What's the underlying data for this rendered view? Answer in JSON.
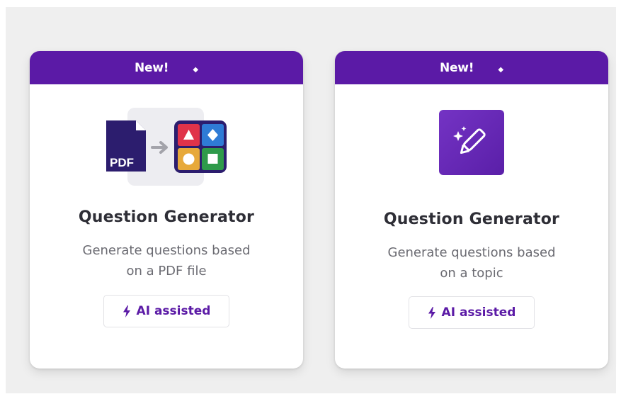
{
  "cards": [
    {
      "banner": "New!",
      "title": "Question Generator",
      "description_line1": "Generate questions based",
      "description_line2": "on a PDF file",
      "badge": "AI assisted",
      "icon": "pdf-to-quiz-icon",
      "pdf_label": "PDF"
    },
    {
      "banner": "New!",
      "title": "Question Generator",
      "description_line1": "Generate questions based",
      "description_line2": "on a topic",
      "badge": "AI assisted",
      "icon": "magic-pen-icon"
    }
  ],
  "colors": {
    "brand_purple": "#5b1aa6",
    "panel_bg": "#efefef",
    "quiz_red": "#e0334a",
    "quiz_blue": "#2f7bd6",
    "quiz_yellow": "#e7a93a",
    "quiz_green": "#2e9a4a"
  }
}
